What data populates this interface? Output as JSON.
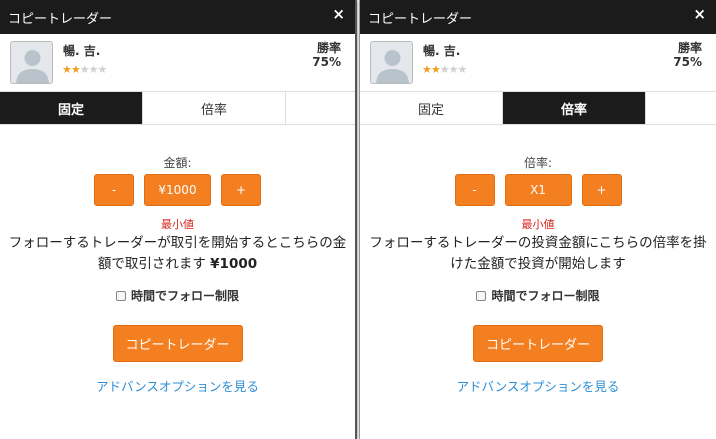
{
  "panels": [
    {
      "title": "コピートレーダー",
      "close_icon": "×",
      "trader": {
        "name": "暢. 吉.",
        "rating": 2,
        "rating_max": 5,
        "winrate_label": "勝率",
        "winrate_value": "75%"
      },
      "tabs": [
        "固定",
        "倍率"
      ],
      "active_tab": 0,
      "field_label": "金額:",
      "minus": "-",
      "value": "¥1000",
      "plus": "+",
      "min_label": "最小値",
      "description": "フォローするトレーダーが取引を開始するとこちらの金額で取引されます",
      "description_amount": "¥1000",
      "checkbox_label": "時間でフォロー制限",
      "copy_button": "コピートレーダー",
      "advanced_link": "アドバンスオプションを見る"
    },
    {
      "title": "コピートレーダー",
      "close_icon": "×",
      "trader": {
        "name": "暢. 吉.",
        "rating": 2,
        "rating_max": 5,
        "winrate_label": "勝率",
        "winrate_value": "75%"
      },
      "tabs": [
        "固定",
        "倍率"
      ],
      "active_tab": 1,
      "field_label": "倍率:",
      "minus": "-",
      "value": "X1",
      "plus": "+",
      "min_label": "最小値",
      "description": "フォローするトレーダーの投資金額にこちらの倍率を掛けた金額で投資が開始します",
      "description_amount": "",
      "checkbox_label": "時間でフォロー制限",
      "copy_button": "コピートレーダー",
      "advanced_link": "アドバンスオプションを見る"
    }
  ],
  "colors": {
    "accent": "#f47f20",
    "titlebar": "#1b1b1b",
    "link": "#2b8fd6",
    "warning": "#d9251c",
    "star_on": "#f0a020",
    "star_off": "#d0d0d0"
  }
}
